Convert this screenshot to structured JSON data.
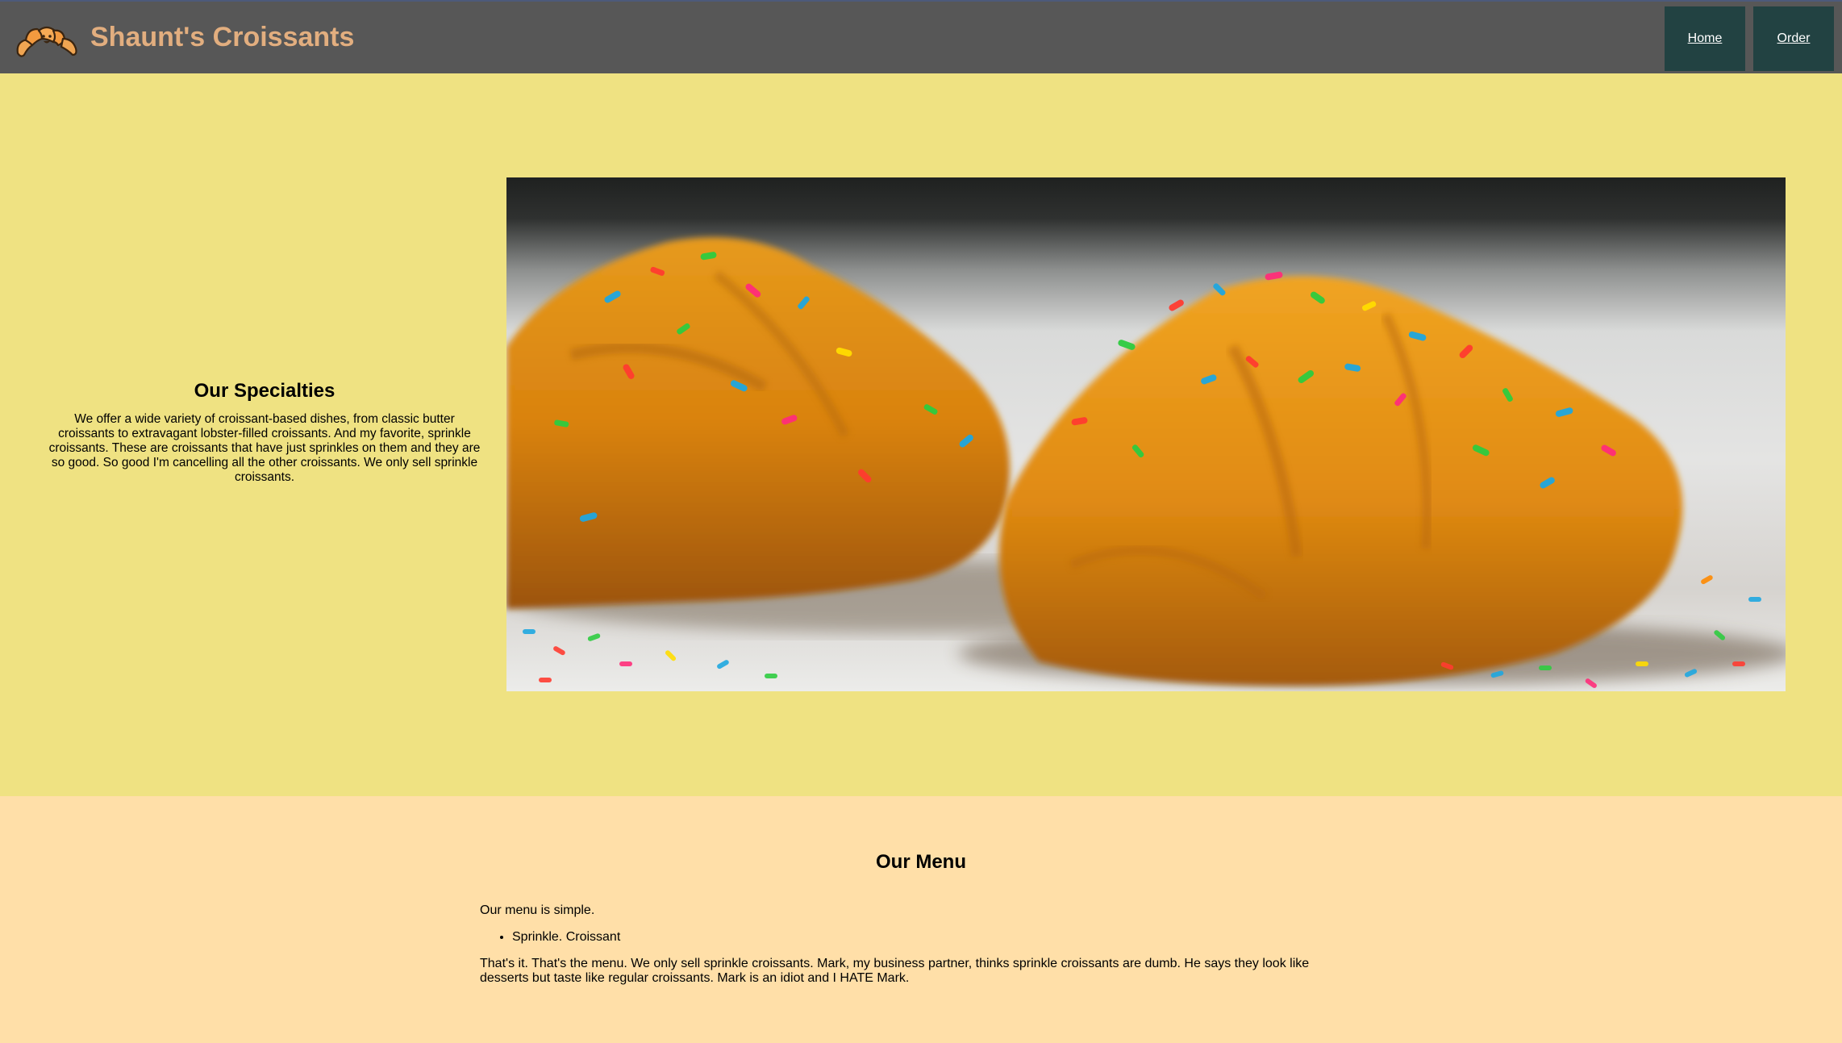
{
  "header": {
    "brand": "Shaunt's Croissants",
    "nav": [
      {
        "label": "Home"
      },
      {
        "label": "Order"
      }
    ]
  },
  "hero": {
    "heading": "Our Specialties",
    "text": "We offer a wide variety of croissant-based dishes, from classic butter croissants to extravagant lobster-filled croissants. And my favorite, sprinkle croissants. These are croissants that have just sprinkles on them and they are so good. So good I'm cancelling all the other croissants. We only sell sprinkle croissants."
  },
  "menu": {
    "heading": "Our Menu",
    "intro": "Our menu is simple.",
    "items": [
      "Sprinkle. Croissant"
    ],
    "outro": "That's it. That's the menu. We only sell sprinkle croissants. Mark, my business partner, thinks sprinkle croissants are dumb. He says they look like desserts but taste like regular croissants. Mark is an idiot and I HATE Mark."
  },
  "colors": {
    "header_bg": "#575757",
    "brand_text": "#e2ae7f",
    "nav_bg": "#224242",
    "hero_bg": "#efe282",
    "menu_bg": "#ffdfa8"
  },
  "icons": {
    "logo": "croissant-logo-icon"
  }
}
